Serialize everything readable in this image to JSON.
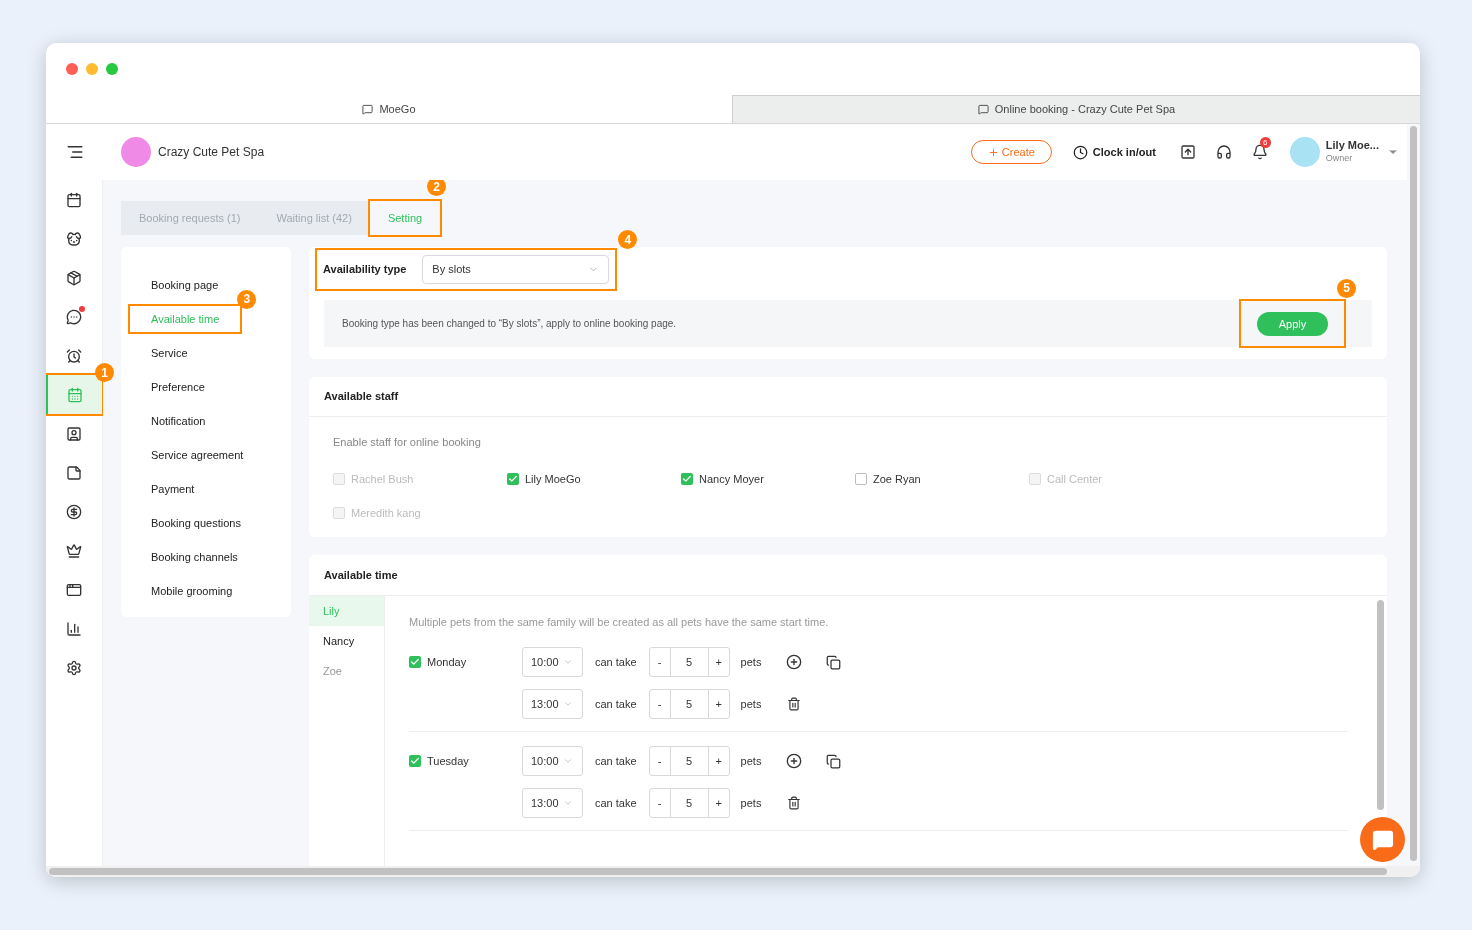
{
  "browser_tabs": [
    {
      "title": "MoeGo",
      "selected": true
    },
    {
      "title": "Online booking - Crazy Cute Pet Spa",
      "selected": false
    }
  ],
  "header": {
    "business": "Crazy Cute Pet Spa",
    "create": "Create",
    "clock": "Clock in/out",
    "notification_count": "6",
    "user_name": "Lily Moe...",
    "user_role": "Owner"
  },
  "nav_icons": [
    {
      "kind": "calendar",
      "selected": false,
      "dot": false
    },
    {
      "kind": "dog",
      "selected": false,
      "dot": false
    },
    {
      "kind": "jar",
      "selected": false,
      "dot": false
    },
    {
      "kind": "chat",
      "selected": false,
      "dot": true
    },
    {
      "kind": "alarm",
      "selected": false,
      "dot": false
    },
    {
      "kind": "booking",
      "selected": true,
      "dot": false,
      "callout": "1"
    },
    {
      "kind": "badge",
      "selected": false,
      "dot": false
    },
    {
      "kind": "note",
      "selected": false,
      "dot": false
    },
    {
      "kind": "dollar",
      "selected": false,
      "dot": false
    },
    {
      "kind": "crown",
      "selected": false,
      "dot": false
    },
    {
      "kind": "window",
      "selected": false,
      "dot": false
    },
    {
      "kind": "chart",
      "selected": false,
      "dot": false
    },
    {
      "kind": "settings",
      "selected": false,
      "dot": false
    }
  ],
  "page_tabs": [
    {
      "label": "Booking requests (1)",
      "selected": false
    },
    {
      "label": "Waiting list (42)",
      "selected": false
    },
    {
      "label": "Setting",
      "selected": true,
      "callout": "2"
    }
  ],
  "settings_menu": [
    {
      "label": "Booking page",
      "selected": false
    },
    {
      "label": "Available time",
      "selected": true,
      "callout": "3"
    },
    {
      "label": "Service",
      "selected": false
    },
    {
      "label": "Preference",
      "selected": false
    },
    {
      "label": "Notification",
      "selected": false
    },
    {
      "label": "Service agreement",
      "selected": false
    },
    {
      "label": "Payment",
      "selected": false
    },
    {
      "label": "Booking questions",
      "selected": false
    },
    {
      "label": "Booking channels",
      "selected": false
    },
    {
      "label": "Mobile grooming",
      "selected": false
    }
  ],
  "availability": {
    "label": "Availability type",
    "value": "By slots",
    "callout": "4",
    "notice": "Booking type has been changed to “By slots”, apply to online booking page.",
    "apply": "Apply",
    "apply_callout": "5"
  },
  "staff": {
    "title": "Available staff",
    "hint": "Enable staff for online booking",
    "members": [
      {
        "name": "Rachel Bush",
        "checked": false,
        "disabled": true
      },
      {
        "name": "Lily MoeGo",
        "checked": true,
        "disabled": false
      },
      {
        "name": "Nancy Moyer",
        "checked": true,
        "disabled": false
      },
      {
        "name": "Zoe Ryan",
        "checked": false,
        "disabled": false
      },
      {
        "name": "Call Center",
        "checked": false,
        "disabled": true
      },
      {
        "name": "Meredith kang",
        "checked": false,
        "disabled": true
      }
    ]
  },
  "available_time": {
    "title": "Available time",
    "staff_tabs": [
      {
        "name": "Lily",
        "selected": true,
        "disabled": false
      },
      {
        "name": "Nancy",
        "selected": false,
        "disabled": false
      },
      {
        "name": "Zoe",
        "selected": false,
        "disabled": true
      }
    ],
    "hint": "Multiple pets from the same family will be created as all pets have the same start time.",
    "days": [
      {
        "name": "Monday",
        "checked": true,
        "slots": [
          {
            "kind": "first",
            "time": "10:00",
            "label": "can take",
            "minus": "-",
            "count": "5",
            "plus": "+",
            "unit": "pets"
          },
          {
            "kind": "extra",
            "time": "13:00",
            "label": "can take",
            "minus": "-",
            "count": "5",
            "plus": "+",
            "unit": "pets"
          }
        ]
      },
      {
        "name": "Tuesday",
        "checked": true,
        "slots": [
          {
            "kind": "first",
            "time": "10:00",
            "label": "can take",
            "minus": "-",
            "count": "5",
            "plus": "+",
            "unit": "pets"
          },
          {
            "kind": "extra",
            "time": "13:00",
            "label": "can take",
            "minus": "-",
            "count": "5",
            "plus": "+",
            "unit": "pets"
          }
        ]
      }
    ]
  }
}
